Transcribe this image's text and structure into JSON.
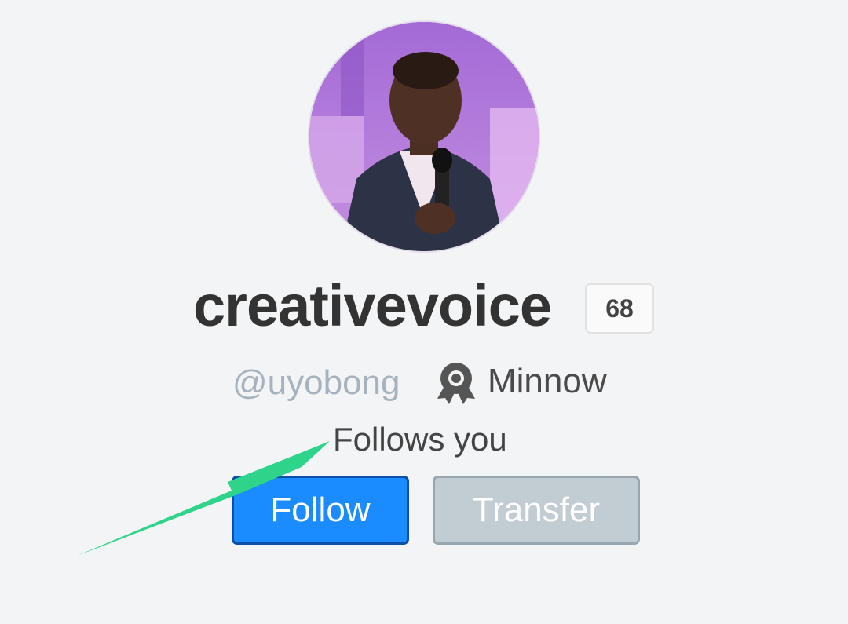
{
  "profile": {
    "display_name": "creativevoice",
    "reputation": "68",
    "handle": "@uyobong",
    "rank": "Minnow",
    "rank_icon": "award-ribbon-icon",
    "follows_you": "Follows you",
    "avatar": "profile-photo"
  },
  "actions": {
    "follow_label": "Follow",
    "transfer_label": "Transfer"
  },
  "colors": {
    "page_background": "#f3f4f6",
    "follow_button": "#1a8cff",
    "transfer_button": "#c1ccd3",
    "annotation_arrow": "#2ed48a"
  }
}
